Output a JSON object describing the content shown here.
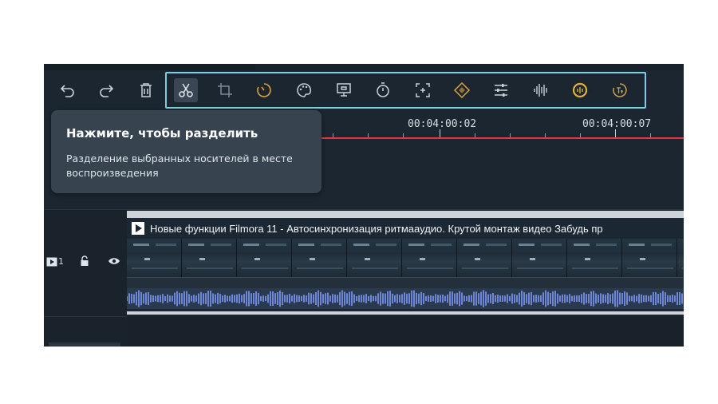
{
  "toolbar": {
    "buttons": [
      {
        "id": "undo",
        "icon": "undo-icon"
      },
      {
        "id": "redo",
        "icon": "redo-icon"
      },
      {
        "id": "delete",
        "icon": "trash-icon"
      },
      {
        "id": "split",
        "icon": "scissors-icon",
        "active": true
      },
      {
        "id": "crop",
        "icon": "crop-icon"
      },
      {
        "id": "speed",
        "icon": "speed-icon",
        "color": "#d8a641"
      },
      {
        "id": "color",
        "icon": "palette-icon"
      },
      {
        "id": "green-screen",
        "icon": "presentation-icon"
      },
      {
        "id": "duration",
        "icon": "timer-icon"
      },
      {
        "id": "zoom",
        "icon": "zoom-frame-icon"
      },
      {
        "id": "keyframe",
        "icon": "keyframe-diamond-icon",
        "color": "#d8a641"
      },
      {
        "id": "adjust",
        "icon": "sliders-icon"
      },
      {
        "id": "audio-beat",
        "icon": "audio-waveform-icon"
      },
      {
        "id": "auto-sync",
        "icon": "audio-sync-icon",
        "color": "#e3b13a"
      },
      {
        "id": "speech-to-text",
        "icon": "speech-to-text-icon",
        "color": "#c9a35c"
      }
    ]
  },
  "ruler": {
    "timecodes": [
      "00:04:00:02",
      "00:04:00:07"
    ],
    "playhead_color": "#e0393a"
  },
  "tooltip": {
    "title": "Нажмите, чтобы разделить",
    "body": "Разделение выбранных носителей в месте воспроизведения"
  },
  "track": {
    "number": "1"
  },
  "clip": {
    "title": "Новые функции Filmora 11 - Автосинхронизация ритмааудио. Крутой монтаж видео  Забудь пр"
  },
  "colors": {
    "accent": "#7fcbe0",
    "panel": "#1c2630",
    "audio_wave": "#6f86d6"
  }
}
